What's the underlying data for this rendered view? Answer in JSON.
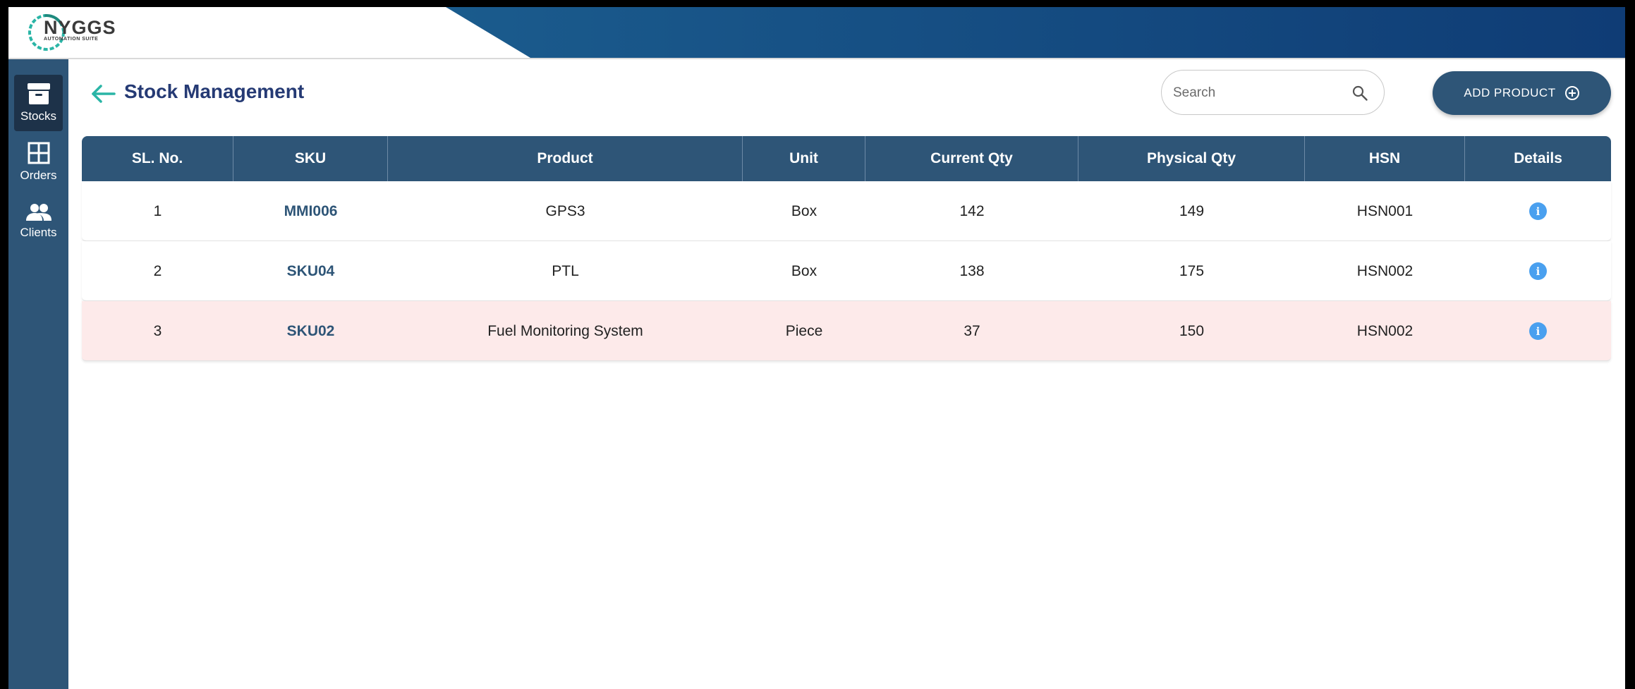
{
  "brand": {
    "name": "NYGGS",
    "tagline": "AUTOMATION SUITE"
  },
  "sidebar": {
    "items": [
      {
        "label": "Stocks",
        "icon": "archive-icon",
        "active": true
      },
      {
        "label": "Orders",
        "icon": "grid-icon",
        "active": false
      },
      {
        "label": "Clients",
        "icon": "people-icon",
        "active": false
      }
    ]
  },
  "page": {
    "title": "Stock Management"
  },
  "search": {
    "placeholder": "Search",
    "value": ""
  },
  "actions": {
    "add_product_label": "ADD PRODUCT"
  },
  "table": {
    "columns": [
      "SL. No.",
      "SKU",
      "Product",
      "Unit",
      "Current Qty",
      "Physical Qty",
      "HSN",
      "Details"
    ],
    "rows": [
      {
        "sl": "1",
        "sku": "MMI006",
        "product": "GPS3",
        "unit": "Box",
        "current_qty": "142",
        "physical_qty": "149",
        "hsn": "HSN001",
        "highlight": false
      },
      {
        "sl": "2",
        "sku": "SKU04",
        "product": "PTL",
        "unit": "Box",
        "current_qty": "138",
        "physical_qty": "175",
        "hsn": "HSN002",
        "highlight": false
      },
      {
        "sl": "3",
        "sku": "SKU02",
        "product": "Fuel Monitoring System",
        "unit": "Piece",
        "current_qty": "37",
        "physical_qty": "150",
        "hsn": "HSN002",
        "highlight": true
      }
    ]
  },
  "colors": {
    "primary": "#2e5577",
    "title": "#253a74",
    "accent": "#2ab5a6",
    "info": "#4aa0ef",
    "low_stock_row": "#fdeaea"
  }
}
